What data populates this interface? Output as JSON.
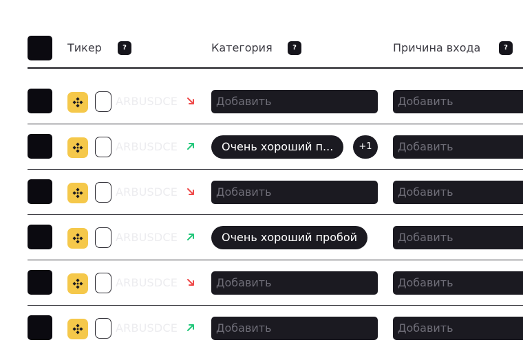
{
  "header": {
    "ticker_label": "Тикер",
    "category_label": "Категория",
    "reason_label": "Причина входа",
    "help_glyph": "?"
  },
  "rows": [
    {
      "ticker": "ARBUSDCE",
      "direction": "down",
      "category": {
        "type": "empty",
        "text": "Добавить"
      },
      "reason": "Добавить"
    },
    {
      "ticker": "ARBUSDCE",
      "direction": "up",
      "category": {
        "type": "tag",
        "text": "Очень хороший п...",
        "extra": "+1"
      },
      "reason": "Добавить"
    },
    {
      "ticker": "ARBUSDCE",
      "direction": "down",
      "category": {
        "type": "empty",
        "text": "Добавить"
      },
      "reason": "Добавить"
    },
    {
      "ticker": "ARBUSDCE",
      "direction": "up",
      "category": {
        "type": "tag",
        "text": "Очень хороший пробой"
      },
      "reason": "Добавить"
    },
    {
      "ticker": "ARBUSDCE",
      "direction": "down",
      "category": {
        "type": "empty",
        "text": "Добавить"
      },
      "reason": "Добавить"
    },
    {
      "ticker": "ARBUSDCE",
      "direction": "up",
      "category": {
        "type": "empty",
        "text": "Добавить"
      },
      "reason": "Добавить"
    }
  ],
  "colors": {
    "down": "#ef4a4a",
    "up": "#22c77a",
    "coin_bg": "#f5c84a",
    "dark": "#1b1a21"
  },
  "icons": {
    "coin": "binance-icon",
    "up": "arrow-up-right-icon",
    "down": "arrow-down-right-icon"
  }
}
